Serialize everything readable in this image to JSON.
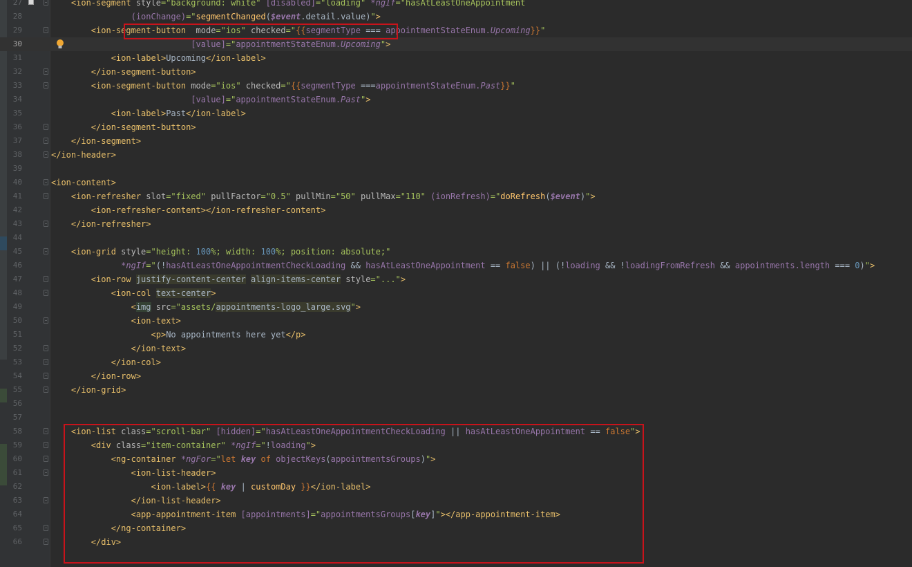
{
  "colors": {
    "background": "#2b2b2b",
    "gutter": "#313335",
    "tag": "#e8bf6a",
    "attribute": "#bababa",
    "string": "#a5c25c",
    "angular_binding": "#9876aa",
    "keyword": "#cc7832",
    "number": "#6897bb",
    "annotation_box": "#c8131b"
  },
  "icons": {
    "bookmark": "bookmark-icon",
    "intention": "lightbulb-icon",
    "fold": "fold-marker-icon"
  },
  "current_line": 30,
  "lines": [
    {
      "n": "27",
      "indent": "    ",
      "bookmark": true,
      "fold": true,
      "t": [
        [
          "tag",
          "<ion-segment "
        ],
        [
          "attr",
          "style"
        ],
        [
          "str",
          "=\"background: white\" "
        ],
        [
          "ng",
          "[disabled]"
        ],
        [
          "str",
          "=\"loading\" "
        ],
        [
          "ngi",
          "*ngIf"
        ],
        [
          "str",
          "=\"hasAtLeastOneAppointment"
        ]
      ]
    },
    {
      "n": "28",
      "indent": "                ",
      "t": [
        [
          "ng",
          "(ionChange)"
        ],
        [
          "str",
          "=\""
        ],
        [
          "fn",
          "segmentChanged"
        ],
        [
          "pl",
          "("
        ],
        [
          "bi",
          "$event"
        ],
        [
          "pl",
          ".detail.value)"
        ],
        [
          "str",
          "\""
        ],
        [
          "tag",
          ">"
        ]
      ]
    },
    {
      "n": "29",
      "indent": "        ",
      "fold": true,
      "t": [
        [
          "tag",
          "<ion-segment-button  "
        ],
        [
          "attr",
          "mode"
        ],
        [
          "str",
          "=\"ios\" "
        ],
        [
          "attr",
          "checked"
        ],
        [
          "str",
          "=\""
        ],
        [
          "kw",
          "{{"
        ],
        [
          "ng",
          "segmentType "
        ],
        [
          "pl",
          "=== "
        ],
        [
          "ng",
          "appointmentStateEnum."
        ],
        [
          "en",
          "Upcoming"
        ],
        [
          "kw",
          "}}"
        ],
        [
          "str",
          "\""
        ]
      ]
    },
    {
      "n": "30",
      "indent": "                            ",
      "current": true,
      "bulb": true,
      "t": [
        [
          "ng",
          "[value]"
        ],
        [
          "str",
          "=\""
        ],
        [
          "ng",
          "appointmentStateEnum."
        ],
        [
          "en",
          "Upcoming"
        ],
        [
          "str",
          "\""
        ],
        [
          "tag",
          ">"
        ]
      ]
    },
    {
      "n": "31",
      "indent": "            ",
      "t": [
        [
          "tag",
          "<ion-label>"
        ],
        [
          "pl",
          "Upcoming"
        ],
        [
          "tag",
          "</ion-label>"
        ]
      ]
    },
    {
      "n": "32",
      "indent": "        ",
      "fold": true,
      "t": [
        [
          "tag",
          "</ion-segment-button>"
        ]
      ]
    },
    {
      "n": "33",
      "indent": "        ",
      "fold": true,
      "t": [
        [
          "tag",
          "<ion-segment-button "
        ],
        [
          "attr",
          "mode"
        ],
        [
          "str",
          "=\"ios\" "
        ],
        [
          "attr",
          "checked"
        ],
        [
          "str",
          "=\""
        ],
        [
          "kw",
          "{{"
        ],
        [
          "ng",
          "segmentType "
        ],
        [
          "pl",
          "==="
        ],
        [
          "ng",
          "appointmentStateEnum."
        ],
        [
          "en",
          "Past"
        ],
        [
          "kw",
          "}}"
        ],
        [
          "str",
          "\""
        ]
      ]
    },
    {
      "n": "34",
      "indent": "                            ",
      "t": [
        [
          "ng",
          "[value]"
        ],
        [
          "str",
          "=\""
        ],
        [
          "ng",
          "appointmentStateEnum."
        ],
        [
          "en",
          "Past"
        ],
        [
          "str",
          "\""
        ],
        [
          "tag",
          ">"
        ]
      ]
    },
    {
      "n": "35",
      "indent": "            ",
      "t": [
        [
          "tag",
          "<ion-label>"
        ],
        [
          "pl",
          "Past"
        ],
        [
          "tag",
          "</ion-label>"
        ]
      ]
    },
    {
      "n": "36",
      "indent": "        ",
      "fold": true,
      "t": [
        [
          "tag",
          "</ion-segment-button>"
        ]
      ]
    },
    {
      "n": "37",
      "indent": "    ",
      "fold": true,
      "t": [
        [
          "tag",
          "</ion-segment>"
        ]
      ]
    },
    {
      "n": "38",
      "indent": "",
      "fold": true,
      "t": [
        [
          "tag",
          "</ion-header>"
        ]
      ]
    },
    {
      "n": "39",
      "indent": "",
      "t": []
    },
    {
      "n": "40",
      "indent": "",
      "fold": true,
      "t": [
        [
          "tag",
          "<ion-content>"
        ]
      ]
    },
    {
      "n": "41",
      "indent": "    ",
      "fold": true,
      "t": [
        [
          "tag",
          "<ion-refresher "
        ],
        [
          "attr",
          "slot"
        ],
        [
          "str",
          "=\"fixed\" "
        ],
        [
          "attr",
          "pullFactor"
        ],
        [
          "str",
          "=\"0.5\" "
        ],
        [
          "attr",
          "pullMin"
        ],
        [
          "str",
          "=\"50\" "
        ],
        [
          "attr",
          "pullMax"
        ],
        [
          "str",
          "=\"110\" "
        ],
        [
          "ng",
          "(ionRefresh)"
        ],
        [
          "str",
          "=\""
        ],
        [
          "fn",
          "doRefresh"
        ],
        [
          "pl",
          "("
        ],
        [
          "bi",
          "$event"
        ],
        [
          "pl",
          ")"
        ],
        [
          "str",
          "\""
        ],
        [
          "tag",
          ">"
        ]
      ]
    },
    {
      "n": "42",
      "indent": "        ",
      "t": [
        [
          "tag",
          "<ion-refresher-content></ion-refresher-content>"
        ]
      ]
    },
    {
      "n": "43",
      "indent": "    ",
      "fold": true,
      "t": [
        [
          "tag",
          "</ion-refresher>"
        ]
      ]
    },
    {
      "n": "44",
      "indent": "",
      "t": []
    },
    {
      "n": "45",
      "indent": "    ",
      "fold": true,
      "t": [
        [
          "tag",
          "<ion-grid "
        ],
        [
          "attr",
          "style"
        ],
        [
          "str",
          "=\"height: "
        ],
        [
          "num",
          "100"
        ],
        [
          "str",
          "%; width: "
        ],
        [
          "num",
          "100"
        ],
        [
          "str",
          "%; position: absolute;\""
        ]
      ]
    },
    {
      "n": "46",
      "indent": "              ",
      "t": [
        [
          "ngi",
          "*ngIf"
        ],
        [
          "str",
          "=\""
        ],
        [
          "pl",
          "(!"
        ],
        [
          "ng",
          "hasAtLeastOneAppointmentCheckLoading "
        ],
        [
          "pl",
          "&& "
        ],
        [
          "ng",
          "hasAtLeastOneAppointment "
        ],
        [
          "pl",
          "== "
        ],
        [
          "kw",
          "false"
        ],
        [
          "pl",
          ") || (!"
        ],
        [
          "ng",
          "loading "
        ],
        [
          "pl",
          "&& !"
        ],
        [
          "ng",
          "loadingFromRefresh "
        ],
        [
          "pl",
          "&& "
        ],
        [
          "ng",
          "appointments.length "
        ],
        [
          "pl",
          "=== "
        ],
        [
          "num",
          "0"
        ],
        [
          "pl",
          ")"
        ],
        [
          "str",
          "\""
        ],
        [
          "tag",
          ">"
        ]
      ]
    },
    {
      "n": "47",
      "indent": "        ",
      "fold": true,
      "t": [
        [
          "tag",
          "<ion-row "
        ],
        [
          "hl",
          "justify-content-center"
        ],
        [
          "pl",
          " "
        ],
        [
          "hl",
          "align-items-center"
        ],
        [
          "pl",
          " "
        ],
        [
          "attr",
          "style"
        ],
        [
          "str",
          "=\"...\""
        ],
        [
          "tag",
          ">"
        ]
      ]
    },
    {
      "n": "48",
      "indent": "            ",
      "fold": true,
      "t": [
        [
          "tag",
          "<ion-col "
        ],
        [
          "hl",
          "text-center"
        ],
        [
          "tag",
          ">"
        ]
      ]
    },
    {
      "n": "49",
      "indent": "                ",
      "t": [
        [
          "tag",
          "<"
        ],
        [
          "hlg",
          "img"
        ],
        [
          "pl",
          " "
        ],
        [
          "attr",
          "src"
        ],
        [
          "str",
          "=\"assets/"
        ],
        [
          "hl",
          "appointments-logo_large.svg"
        ],
        [
          "str",
          "\""
        ],
        [
          "tag",
          ">"
        ]
      ]
    },
    {
      "n": "50",
      "indent": "                ",
      "fold": true,
      "t": [
        [
          "tag",
          "<ion-text>"
        ]
      ]
    },
    {
      "n": "51",
      "indent": "                    ",
      "t": [
        [
          "tag",
          "<p>"
        ],
        [
          "pl",
          "No appointments here yet"
        ],
        [
          "tag",
          "</p>"
        ]
      ]
    },
    {
      "n": "52",
      "indent": "                ",
      "fold": true,
      "t": [
        [
          "tag",
          "</ion-text>"
        ]
      ]
    },
    {
      "n": "53",
      "indent": "            ",
      "fold": true,
      "t": [
        [
          "tag",
          "</ion-col>"
        ]
      ]
    },
    {
      "n": "54",
      "indent": "        ",
      "fold": true,
      "t": [
        [
          "tag",
          "</ion-row>"
        ]
      ]
    },
    {
      "n": "55",
      "indent": "    ",
      "fold": true,
      "t": [
        [
          "tag",
          "</ion-grid>"
        ]
      ]
    },
    {
      "n": "56",
      "indent": "",
      "t": []
    },
    {
      "n": "57",
      "indent": "",
      "t": []
    },
    {
      "n": "58",
      "indent": "    ",
      "fold": true,
      "t": [
        [
          "tag",
          "<ion-list "
        ],
        [
          "attr",
          "class"
        ],
        [
          "str",
          "=\"scroll-bar\" "
        ],
        [
          "ng",
          "[hidden]"
        ],
        [
          "str",
          "=\""
        ],
        [
          "ng",
          "hasAtLeastOneAppointmentCheckLoading "
        ],
        [
          "pl",
          "|| "
        ],
        [
          "ng",
          "hasAtLeastOneAppointment "
        ],
        [
          "pl",
          "== "
        ],
        [
          "kw",
          "false"
        ],
        [
          "str",
          "\""
        ],
        [
          "tag",
          ">"
        ]
      ]
    },
    {
      "n": "59",
      "indent": "        ",
      "fold": true,
      "t": [
        [
          "tag",
          "<div "
        ],
        [
          "attr",
          "class"
        ],
        [
          "str",
          "=\"item-container\" "
        ],
        [
          "ngi",
          "*ngIf"
        ],
        [
          "str",
          "=\""
        ],
        [
          "pl",
          "!"
        ],
        [
          "ng",
          "loading"
        ],
        [
          "str",
          "\""
        ],
        [
          "tag",
          ">"
        ]
      ]
    },
    {
      "n": "60",
      "indent": "            ",
      "fold": true,
      "t": [
        [
          "tag",
          "<ng-container "
        ],
        [
          "ngi",
          "*ngFor"
        ],
        [
          "str",
          "=\""
        ],
        [
          "kw",
          "let "
        ],
        [
          "bi",
          "key "
        ],
        [
          "kw",
          "of "
        ],
        [
          "ng",
          "objectKeys"
        ],
        [
          "pl",
          "("
        ],
        [
          "ng",
          "appointmentsGroups"
        ],
        [
          "pl",
          ")"
        ],
        [
          "str",
          "\""
        ],
        [
          "tag",
          ">"
        ]
      ]
    },
    {
      "n": "61",
      "indent": "                ",
      "fold": true,
      "t": [
        [
          "tag",
          "<ion-list-header>"
        ]
      ]
    },
    {
      "n": "62",
      "indent": "                    ",
      "t": [
        [
          "tag",
          "<ion-label>"
        ],
        [
          "kw",
          "{{ "
        ],
        [
          "bi",
          "key"
        ],
        [
          "pl",
          " | "
        ],
        [
          "fn",
          "customDay"
        ],
        [
          "kw",
          " }}"
        ],
        [
          "tag",
          "</ion-label>"
        ]
      ]
    },
    {
      "n": "63",
      "indent": "                ",
      "fold": true,
      "t": [
        [
          "tag",
          "</ion-list-header>"
        ]
      ]
    },
    {
      "n": "64",
      "indent": "                ",
      "t": [
        [
          "tag",
          "<app-appointment-item "
        ],
        [
          "ng",
          "[appointments]"
        ],
        [
          "str",
          "=\""
        ],
        [
          "ng",
          "appointmentsGroups"
        ],
        [
          "pl",
          "["
        ],
        [
          "bi",
          "key"
        ],
        [
          "pl",
          "]"
        ],
        [
          "str",
          "\""
        ],
        [
          "tag",
          "></app-appointment-item>"
        ]
      ]
    },
    {
      "n": "65",
      "indent": "            ",
      "fold": true,
      "t": [
        [
          "tag",
          "</ng-container>"
        ]
      ]
    },
    {
      "n": "66",
      "indent": "        ",
      "fold": true,
      "t": [
        [
          "tag",
          "</div>"
        ]
      ]
    }
  ]
}
